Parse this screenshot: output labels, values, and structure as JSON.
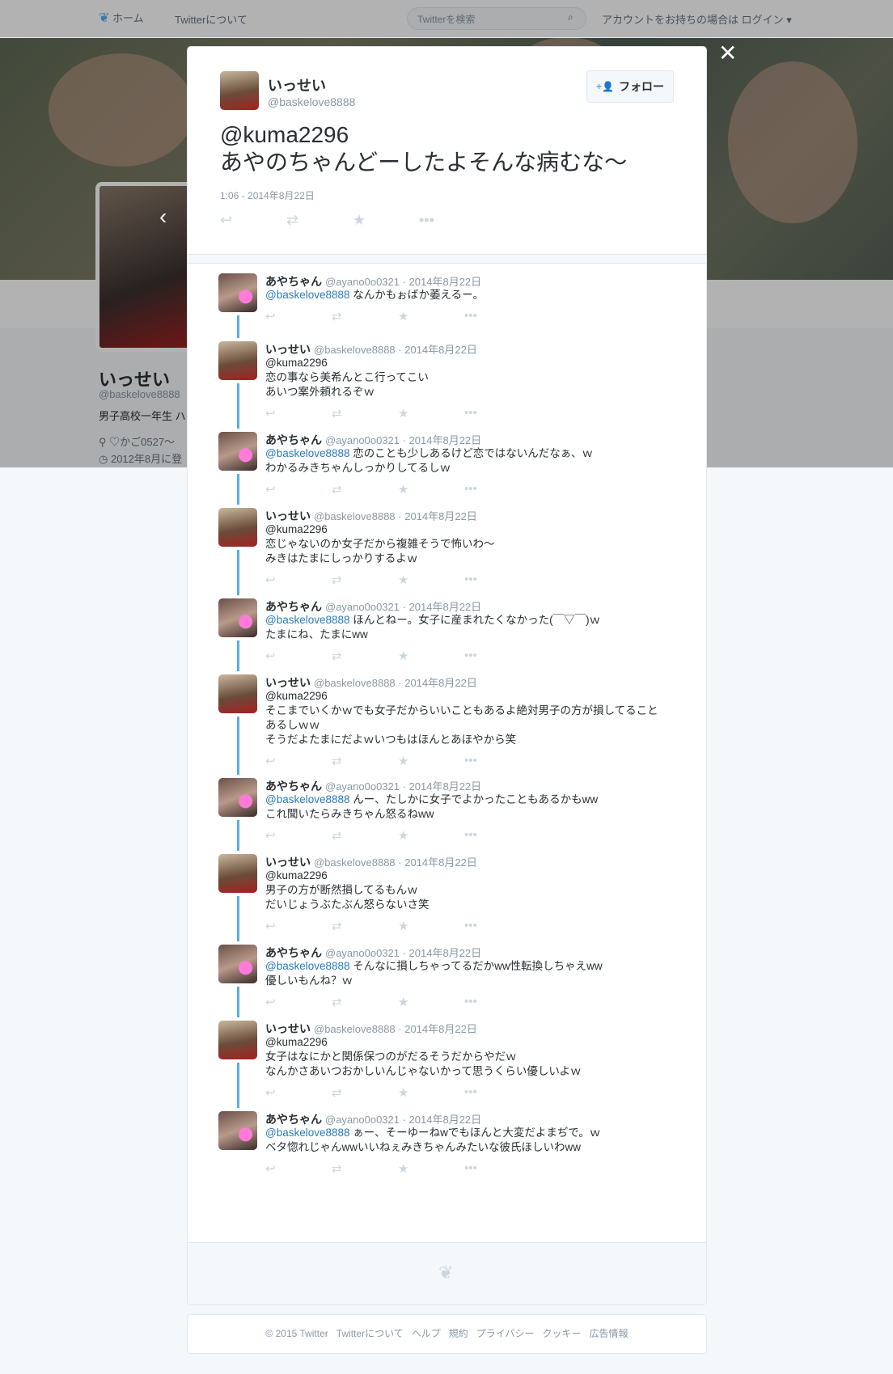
{
  "topbar": {
    "home_label": "ホーム",
    "about_label": "Twitterについて",
    "search_placeholder": "Twitterを検索",
    "login_prompt": "アカウントをお持ちの場合は ログイン"
  },
  "profile": {
    "name": "いっせい",
    "handle": "@baskelove8888",
    "bio": "男子高校一年生 ハ",
    "location": "♡かご0527〜",
    "joined": "2012年8月に登"
  },
  "main_tweet": {
    "name": "いっせい",
    "handle": "@baskelove8888",
    "follow_label": "フォロー",
    "text": "@kuma2296\nあやのちゃんどーしたよそんな病むな〜",
    "timestamp": "1:06 - 2014年8月22日"
  },
  "replies": [
    {
      "user": "aya",
      "name": "あやちゃん",
      "meta": "@ayano0o0321 · 2014年8月22日",
      "lines": [
        "<m>@baskelove8888</m> なんかもぉばか萎えるー。"
      ]
    },
    {
      "user": "issei",
      "name": "いっせい",
      "meta": "@baskelove8888 · 2014年8月22日",
      "lines": [
        "@kuma2296",
        "恋の事なら美希んとこ行ってこい",
        "あいつ案外頼れるぞｗ"
      ]
    },
    {
      "user": "aya",
      "name": "あやちゃん",
      "meta": "@ayano0o0321 · 2014年8月22日",
      "lines": [
        "<m>@baskelove8888</m> 恋のことも少しあるけど恋ではないんだなぁ、ｗ",
        "わかるみきちゃんしっかりしてるしｗ"
      ]
    },
    {
      "user": "issei",
      "name": "いっせい",
      "meta": "@baskelove8888 · 2014年8月22日",
      "lines": [
        "@kuma2296",
        "恋じゃないのか女子だから複雑そうで怖いわ〜",
        "みきはたまにしっかりするよｗ"
      ]
    },
    {
      "user": "aya",
      "name": "あやちゃん",
      "meta": "@ayano0o0321 · 2014年8月22日",
      "lines": [
        "<m>@baskelove8888</m> ほんとねー。女子に産まれたくなかった(￣▽￣)ｗ",
        "たまにね、たまにww"
      ]
    },
    {
      "user": "issei",
      "name": "いっせい",
      "meta": "@baskelove8888 · 2014年8月22日",
      "lines": [
        "@kuma2296",
        "そこまでいくかｗでも女子だからいいこともあるよ絶対男子の方が損してること",
        "あるしｗｗ",
        "そうだよたまにだよｗいつもはほんとあほやから笑"
      ]
    },
    {
      "user": "aya",
      "name": "あやちゃん",
      "meta": "@ayano0o0321 · 2014年8月22日",
      "lines": [
        "<m>@baskelove8888</m> んー、たしかに女子でよかったこともあるかもww",
        "これ聞いたらみきちゃん怒るねww"
      ]
    },
    {
      "user": "issei",
      "name": "いっせい",
      "meta": "@baskelove8888 · 2014年8月22日",
      "lines": [
        "@kuma2296",
        "男子の方が断然損してるもんｗ",
        "だいじょうぶたぶん怒らないさ笑"
      ]
    },
    {
      "user": "aya",
      "name": "あやちゃん",
      "meta": "@ayano0o0321 · 2014年8月22日",
      "lines": [
        "<m>@baskelove8888</m> そんなに損しちゃってるだかww性転換しちゃえww",
        "優しいもんね？ｗ"
      ]
    },
    {
      "user": "issei",
      "name": "いっせい",
      "meta": "@baskelove8888 · 2014年8月22日",
      "lines": [
        "@kuma2296",
        "女子はなにかと関係保つのがだるそうだからやだｗ",
        "なんかさあいつおかしいんじゃないかって思うくらい優しいよｗ"
      ]
    },
    {
      "user": "aya",
      "name": "あやちゃん",
      "meta": "@ayano0o0321 · 2014年8月22日",
      "lines": [
        "<m>@baskelove8888</m> ぁー、そーゆーねwでもほんと大変だよまぢで。ｗ",
        "ベタ惚れじゃんwwいいねぇみきちゃんみたいな彼氏ほしいわww"
      ]
    }
  ],
  "icons": {
    "reply": "reply-icon",
    "retweet": "retweet-icon",
    "favorite": "star-icon",
    "more": "more-icon"
  },
  "colors": {
    "accent": "#55acee",
    "mention": "#2b7bb9",
    "muted": "#8899a6"
  },
  "footer": {
    "links": [
      "© 2015 Twitter",
      "Twitterについて",
      "ヘルプ",
      "規約",
      "プライバシー",
      "クッキー",
      "広告情報"
    ]
  }
}
